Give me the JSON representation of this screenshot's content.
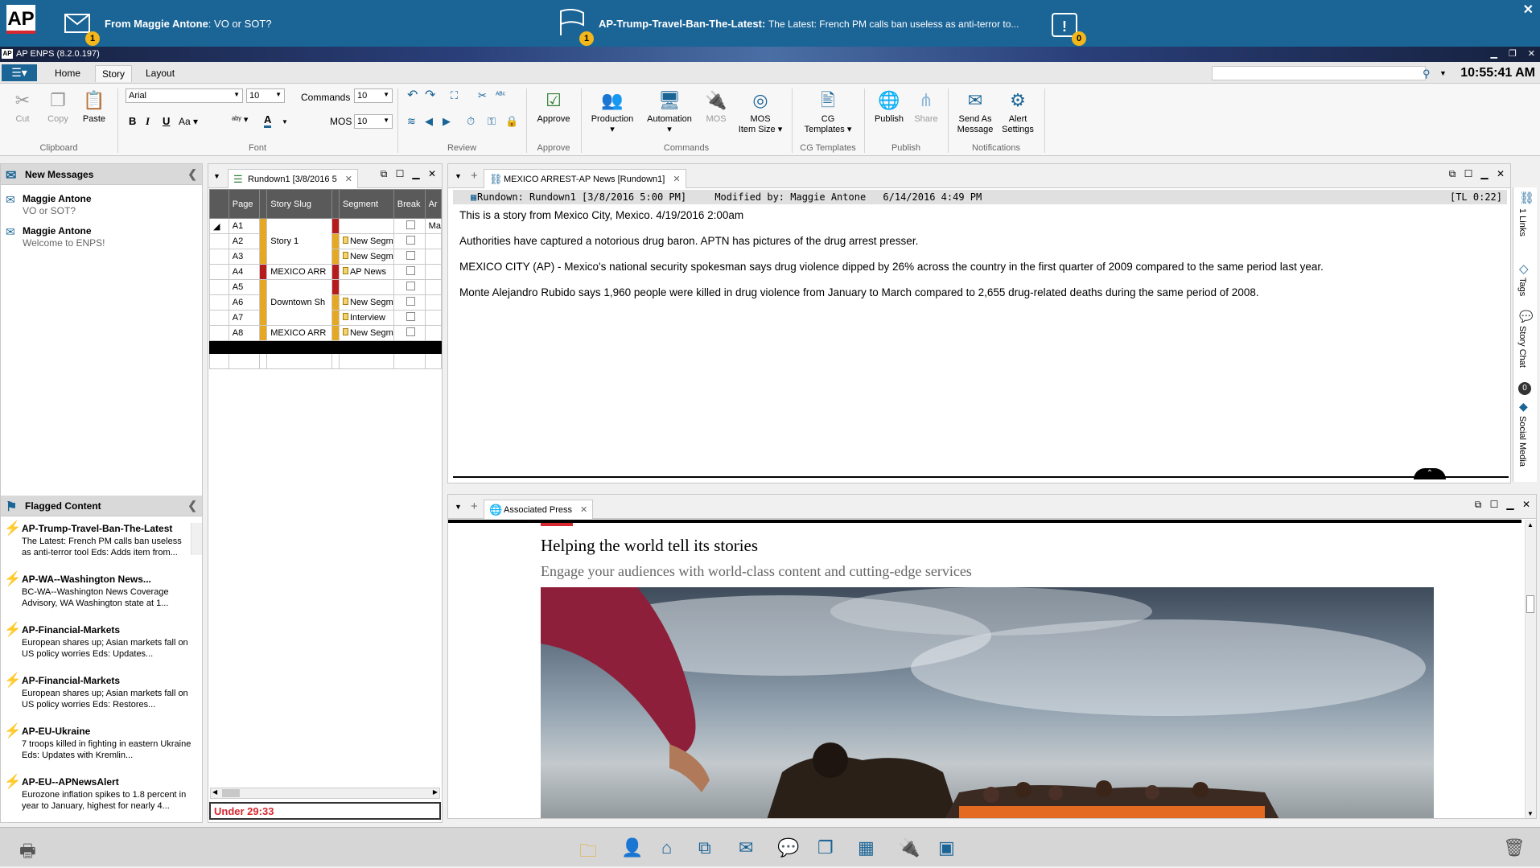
{
  "notifications": {
    "message": {
      "prefix": "From Maggie Antone",
      "text": "VO or SOT?",
      "count": "1"
    },
    "flag": {
      "slug": "AP-Trump-Travel-Ban-The-Latest:",
      "text": "The Latest: French PM calls ban useless as anti-terror to...",
      "count": "1"
    },
    "alerts": {
      "count": "0"
    },
    "logo": "AP"
  },
  "app": {
    "title": "AP ENPS (8.2.0.197)"
  },
  "tabs": [
    "Home",
    "Story",
    "Layout"
  ],
  "active_tab": "Story",
  "clock": "10:55:41 AM",
  "ribbon": {
    "clipboard": {
      "label": "Clipboard",
      "cut": "Cut",
      "copy": "Copy",
      "paste": "Paste"
    },
    "font": {
      "label": "Font",
      "family": "Arial",
      "size": "10",
      "bold": "B",
      "italic": "I",
      "underline": "U",
      "case": "Aa"
    },
    "commands_field": {
      "label": "Commands",
      "value": "10"
    },
    "mos_field": {
      "label": "MOS",
      "value": "10"
    },
    "review": {
      "label": "Review"
    },
    "approve": {
      "label": "Approve",
      "button": "Approve"
    },
    "commands": {
      "label": "Commands",
      "production": "Production",
      "automation": "Automation",
      "mos": "MOS",
      "mos_item_size_1": "MOS",
      "mos_item_size_2": "Item Size"
    },
    "cg": {
      "label": "CG Templates",
      "button_1": "CG",
      "button_2": "Templates"
    },
    "publish": {
      "label": "Publish",
      "publish": "Publish",
      "share": "Share"
    },
    "notifications": {
      "label": "Notifications",
      "send_1": "Send As",
      "send_2": "Message",
      "alert_1": "Alert",
      "alert_2": "Settings"
    }
  },
  "new_messages": {
    "title": "New Messages",
    "items": [
      {
        "from": "Maggie Antone",
        "subject": "VO or SOT?"
      },
      {
        "from": "Maggie Antone",
        "subject": "Welcome to ENPS!"
      }
    ]
  },
  "flagged": {
    "title": "Flagged Content",
    "items": [
      {
        "slug": "AP-Trump-Travel-Ban-The-Latest",
        "desc": "The Latest: French PM calls ban useless as anti-terror tool Eds: Adds item from..."
      },
      {
        "slug": "AP-WA--Washington News...",
        "desc": "BC-WA--Washington News Coverage Advisory, WA   Washington state at 1..."
      },
      {
        "slug": "AP-Financial-Markets",
        "desc": "European shares up; Asian markets fall on US policy worries Eds: Updates..."
      },
      {
        "slug": "AP-Financial-Markets",
        "desc": "European shares up; Asian markets fall on US policy worries Eds: Restores..."
      },
      {
        "slug": "AP-EU-Ukraine",
        "desc": "7 troops killed in fighting in eastern Ukraine Eds: Updates with Kremlin..."
      },
      {
        "slug": "AP-EU--APNewsAlert",
        "desc": "Eurozone inflation spikes to 1.8 percent in year to January, highest for nearly 4..."
      }
    ]
  },
  "rundown": {
    "tab": "Rundown1 [3/8/2016 5",
    "columns": [
      "Page",
      "Story Slug",
      "Segment",
      "Break",
      "Ar"
    ],
    "rows": [
      {
        "page": "A1",
        "slug": "",
        "segment": "",
        "extra": "Ma"
      },
      {
        "page": "A2",
        "slug": "Story 1",
        "segment": "New Segm",
        "extra": ""
      },
      {
        "page": "A3",
        "slug": "",
        "segment": "New Segm",
        "extra": ""
      },
      {
        "page": "A4",
        "slug": "MEXICO ARR",
        "segment": "AP News",
        "extra": ""
      },
      {
        "page": "A5",
        "slug": "",
        "segment": "",
        "extra": ""
      },
      {
        "page": "A6",
        "slug": "Downtown Sh",
        "segment": "New Segm",
        "extra": ""
      },
      {
        "page": "A7",
        "slug": "",
        "segment": "Interview",
        "extra": ""
      },
      {
        "page": "A8",
        "slug": "MEXICO ARR",
        "segment": "New Segm",
        "extra": ""
      }
    ],
    "under": "Under 29:33"
  },
  "story": {
    "tab": "MEXICO ARREST-AP News [Rundown1]",
    "info_rundown": "Rundown: Rundown1 [3/8/2016 5:00 PM]",
    "info_modified": "Modified by: Maggie Antone",
    "info_date": "6/14/2016 4:49 PM",
    "info_tl": "[TL 0:22]",
    "paragraphs": [
      "This is a story from Mexico City, Mexico. 4/19/2016 2:00am",
      "Authorities have captured a notorious drug baron. APTN has pictures of the drug arrest presser.",
      "MEXICO CITY (AP) - Mexico's national security spokesman says drug violence dipped by 26% across the country in the first quarter of 2009 compared to the same period last year.",
      "Monte Alejandro Rubido says 1,960 people were killed in drug violence from January to March compared to 2,655 drug-related deaths during the same period of 2008."
    ]
  },
  "rail": {
    "links": "1 Links",
    "tags": "Tags",
    "chat": "Story Chat",
    "chat_count": "0",
    "social": "Social Media"
  },
  "browser": {
    "tab": "Associated Press",
    "headline": "Helping the world tell its stories",
    "subhead": "Engage your audiences with world-class content and cutting-edge services"
  }
}
